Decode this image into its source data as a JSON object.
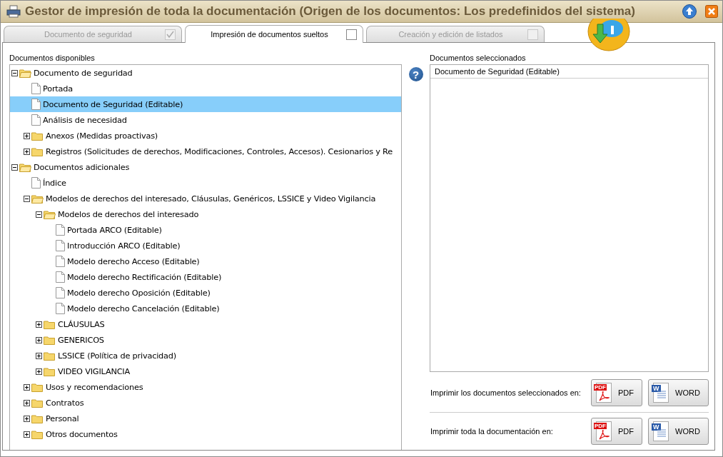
{
  "window": {
    "title": "Gestor de impresión de toda la documentación (Origen de los documentos: Los predefinidos del sistema)"
  },
  "tabs": [
    {
      "label": "Documento de seguridad",
      "selected": false,
      "checked": true,
      "disabled": true
    },
    {
      "label": "Impresión de documentos sueltos",
      "selected": true,
      "checked": false,
      "disabled": false
    },
    {
      "label": "Creación y edición de listados",
      "selected": false,
      "checked": false,
      "disabled": true
    }
  ],
  "available": {
    "label": "Documentos disponibles",
    "help": "?",
    "tree": [
      {
        "kind": "folder",
        "label": "Documento de seguridad",
        "expanded": true,
        "selected": false,
        "children": [
          {
            "kind": "doc",
            "label": "Portada",
            "selected": false
          },
          {
            "kind": "doc",
            "label": "Documento de Seguridad (Editable)",
            "selected": true
          },
          {
            "kind": "doc",
            "label": "Análisis de necesidad",
            "selected": false
          },
          {
            "kind": "folder",
            "label": "Anexos (Medidas proactivas)",
            "expanded": false,
            "selected": false
          },
          {
            "kind": "folder",
            "label": "Registros (Solicitudes de derechos, Modificaciones, Controles, Accesos). Cesionarios y Re",
            "expanded": false,
            "selected": false
          }
        ]
      },
      {
        "kind": "folder",
        "label": "Documentos adicionales",
        "expanded": true,
        "selected": false,
        "children": [
          {
            "kind": "doc",
            "label": "Índice",
            "selected": false
          },
          {
            "kind": "folder",
            "label": "Modelos de derechos del interesado, Cláusulas, Genéricos, LSSICE y Video Vigilancia",
            "expanded": true,
            "selected": false,
            "children": [
              {
                "kind": "folder",
                "label": "Modelos de derechos del interesado",
                "expanded": true,
                "selected": false,
                "children": [
                  {
                    "kind": "doc",
                    "label": "Portada ARCO (Editable)",
                    "selected": false
                  },
                  {
                    "kind": "doc",
                    "label": "Introducción ARCO (Editable)",
                    "selected": false
                  },
                  {
                    "kind": "doc",
                    "label": "Modelo derecho Acceso (Editable)",
                    "selected": false
                  },
                  {
                    "kind": "doc",
                    "label": "Modelo derecho Rectificación (Editable)",
                    "selected": false
                  },
                  {
                    "kind": "doc",
                    "label": "Modelo derecho Oposición (Editable)",
                    "selected": false
                  },
                  {
                    "kind": "doc",
                    "label": "Modelo derecho Cancelación (Editable)",
                    "selected": false
                  }
                ]
              },
              {
                "kind": "folder",
                "label": "CLÁUSULAS",
                "expanded": false,
                "selected": false
              },
              {
                "kind": "folder",
                "label": "GENERICOS",
                "expanded": false,
                "selected": false
              },
              {
                "kind": "folder",
                "label": "LSSICE (Política de privacidad)",
                "expanded": false,
                "selected": false
              },
              {
                "kind": "folder",
                "label": "VIDEO VIGILANCIA",
                "expanded": false,
                "selected": false
              }
            ]
          },
          {
            "kind": "folder",
            "label": "Usos y recomendaciones",
            "expanded": false,
            "selected": false
          },
          {
            "kind": "folder",
            "label": "Contratos",
            "expanded": false,
            "selected": false
          },
          {
            "kind": "folder",
            "label": "Personal",
            "expanded": false,
            "selected": false
          },
          {
            "kind": "folder",
            "label": "Otros documentos",
            "expanded": false,
            "selected": false
          }
        ]
      }
    ]
  },
  "selected_docs": {
    "label": "Documentos seleccionados",
    "items": [
      "Documento de Seguridad (Editable)"
    ]
  },
  "print_rows": [
    {
      "label": "Imprimir los documentos seleccionados en:",
      "buttons": [
        {
          "kind": "pdf",
          "label": "PDF",
          "icon_text": "PDF"
        },
        {
          "kind": "word",
          "label": "WORD",
          "icon_text": "W"
        }
      ]
    },
    {
      "label": "Imprimir toda la documentación en:",
      "buttons": [
        {
          "kind": "pdf",
          "label": "PDF",
          "icon_text": "PDF"
        },
        {
          "kind": "word",
          "label": "WORD",
          "icon_text": "W"
        }
      ]
    }
  ]
}
